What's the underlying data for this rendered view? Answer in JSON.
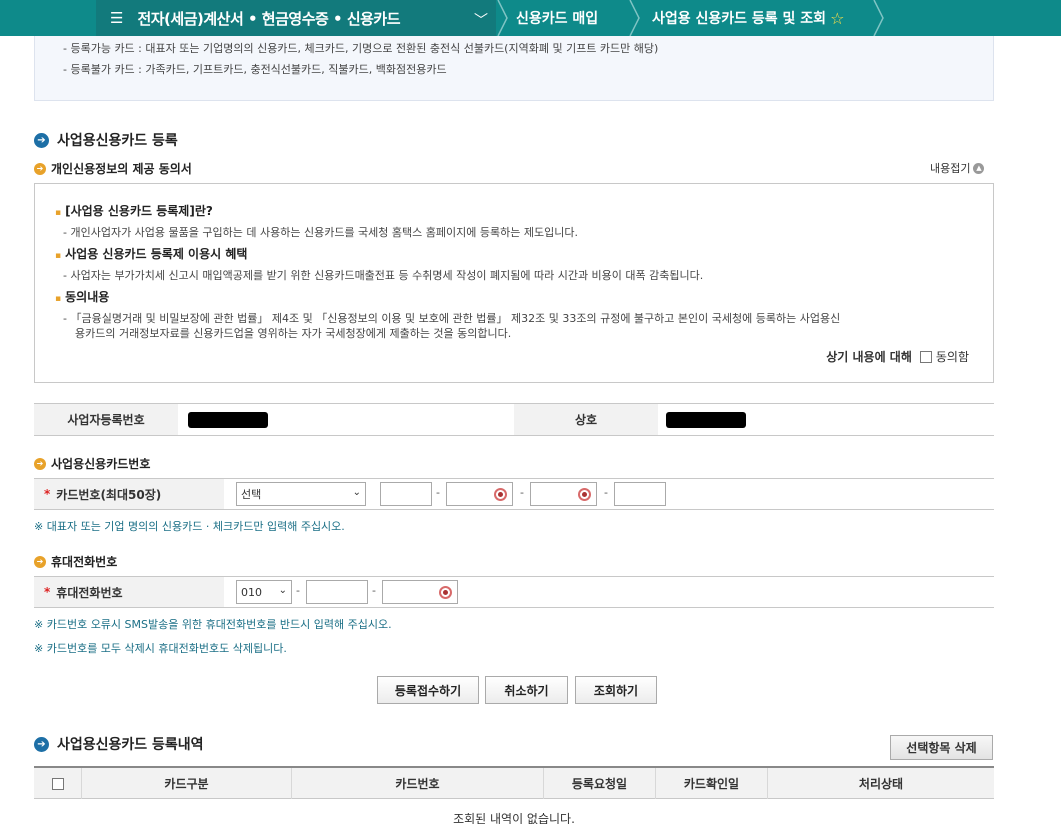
{
  "nav": {
    "menu_title": "전자(세금)계산서 • 현금영수증 • 신용카드",
    "crumb1": "신용카드 매입",
    "crumb2": "사업용 신용카드 등록 및 조회"
  },
  "info": {
    "line1": "- 등록가능 카드 : 대표자 또는 기업명의의 신용카드, 체크카드, 기명으로 전환된 충전식 선불카드(지역화폐 및 기프트 카드만 해당)",
    "line2": "- 등록불가 카드 : 가족카드, 기프트카드, 충전식선불카드, 직불카드, 백화점전용카드"
  },
  "register": {
    "title": "사업용신용카드 등록",
    "consent_title": "개인신용정보의 제공 동의서",
    "fold_label": "내용접기",
    "q1": "[사업용 신용카드 등록제]란?",
    "a1": "- 개인사업자가 사업용 물품을 구입하는 데 사용하는 신용카드를 국세청 홈택스 홈페이지에 등록하는 제도입니다.",
    "q2": "사업용 신용카드 등록제 이용시 혜택",
    "a2": "- 사업자는 부가가치세 신고시 매입액공제를 받기 위한 신용카드매출전표 등 수취명세 작성이 폐지됨에 따라 시간과 비용이 대폭 감축됩니다.",
    "q3": "동의내용",
    "a3_line1": "- 「금융실명거래 및 비밀보장에 관한 법률」 제4조 및 「신용정보의 이용 및 보호에 관한 법률」 제32조 및 33조의 규정에 불구하고 본인이 국세청에 등록하는 사업용신",
    "a3_line2": "용카드의    거래정보자료를 신용카드업을 영위하는 자가 국세청장에게 제출하는 것을 동의합니다.",
    "agree_prefix": "상기 내용에 대해",
    "agree_label": "동의함"
  },
  "biz": {
    "regno_label": "사업자등록번호",
    "name_label": "상호"
  },
  "card": {
    "section": "사업용신용카드번호",
    "label": "카드번호(최대50장)",
    "select_value": "선택",
    "note": "※ 대표자 또는 기업 명의의 신용카드 · 체크카드만 입력해 주십시오."
  },
  "phone": {
    "section": "휴대전화번호",
    "label": "휴대전화번호",
    "prefix_value": "010",
    "note1": "※ 카드번호 오류시 SMS발송을 위한 휴대전화번호를 반드시 입력해 주십시오.",
    "note2": "※ 카드번호를 모두 삭제시 휴대전화번호도 삭제됩니다."
  },
  "buttons": {
    "submit": "등록접수하기",
    "cancel": "취소하기",
    "lookup": "조회하기"
  },
  "history": {
    "title": "사업용신용카드 등록내역",
    "delete_btn": "선택항목 삭제",
    "columns": [
      "카드구분",
      "카드번호",
      "등록요청일",
      "카드확인일",
      "처리상태"
    ],
    "empty": "조회된 내역이 없습니다."
  },
  "colors": {
    "nav_bg": "#0e8a8a",
    "accent_orange": "#e8a22a",
    "accent_blue": "#1d6fa6"
  }
}
